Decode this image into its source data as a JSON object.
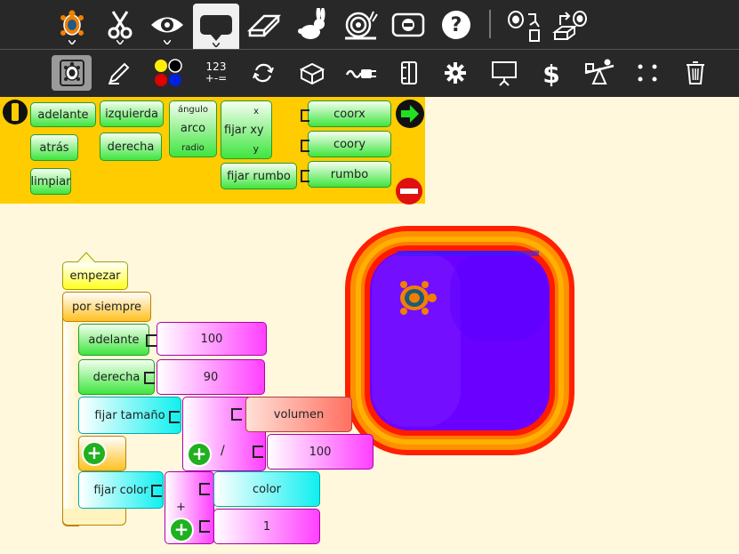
{
  "toolbar_main": [
    {
      "name": "turtle-menu-button",
      "icon": "turtle-icon"
    },
    {
      "name": "cut-button",
      "icon": "scissors-icon"
    },
    {
      "name": "view-button",
      "icon": "eye-icon"
    },
    {
      "name": "palette-toggle-button",
      "icon": "speech-icon"
    },
    {
      "name": "eraser-button",
      "icon": "eraser-icon"
    },
    {
      "name": "run-fast-button",
      "icon": "rabbit-icon"
    },
    {
      "name": "run-slow-button",
      "icon": "snail-icon"
    },
    {
      "name": "stop-button",
      "icon": "stop-icon"
    },
    {
      "name": "help-button",
      "icon": "help-icon"
    },
    {
      "name": "load-project-button",
      "icon": "turtle-load-icon"
    },
    {
      "name": "save-project-button",
      "icon": "turtle-save-icon"
    }
  ],
  "toolbar_palettes": [
    {
      "name": "turtle-palette-tab",
      "icon": "turtle-icon"
    },
    {
      "name": "pen-palette-tab",
      "icon": "pen-icon"
    },
    {
      "name": "colors-palette-tab",
      "icon": "color-dots-icon"
    },
    {
      "name": "numbers-palette-tab",
      "icon": "numbers-icon",
      "line1": "123",
      "line2": "+-="
    },
    {
      "name": "flow-palette-tab",
      "icon": "loop-icon"
    },
    {
      "name": "blocks-palette-tab",
      "icon": "box-icon"
    },
    {
      "name": "sensors-palette-tab",
      "icon": "sensor-icon"
    },
    {
      "name": "media-palette-tab",
      "icon": "media-icon"
    },
    {
      "name": "extras-palette-tab",
      "icon": "gear-icon"
    },
    {
      "name": "presentation-palette-tab",
      "icon": "presentation-icon"
    },
    {
      "name": "portfolio-palette-tab",
      "icon": "dollar-icon"
    },
    {
      "name": "turtles-palette-tab",
      "icon": "seesaw-icon"
    },
    {
      "name": "more-palette-tab",
      "icon": "dots-icon"
    },
    {
      "name": "trash-palette-tab",
      "icon": "trash-icon"
    }
  ],
  "palette_blocks": {
    "adelante": "adelante",
    "atras": "atrás",
    "limpiar": "limpiar",
    "izquierda": "izquierda",
    "derecha": "derecha",
    "angulo": "ángulo",
    "arco": "arco",
    "radio": "radio",
    "fijar_xy": "fijar xy",
    "x": "x",
    "y": "y",
    "fijar_rumbo": "fijar rumbo",
    "coorx": "coorx",
    "coory": "coory",
    "rumbo": "rumbo"
  },
  "program": {
    "start": "empezar",
    "forever": "por siempre",
    "forward": "adelante",
    "forward_value": "100",
    "right": "derecha",
    "right_value": "90",
    "set_size": "fijar tamaño",
    "volume": "volumen",
    "divide_sign": "/",
    "divisor": "100",
    "set_color": "fijar color",
    "color": "color",
    "plus_sign": "+",
    "addend": "1"
  },
  "colors": {
    "toolbar_bg": "#282828",
    "palette_bg": "#ffcc00",
    "canvas_bg": "#fff8dc",
    "stage_inner": "#6a00ff",
    "accent_green": "#3fe53f",
    "accent_pink": "#ff40ff"
  }
}
